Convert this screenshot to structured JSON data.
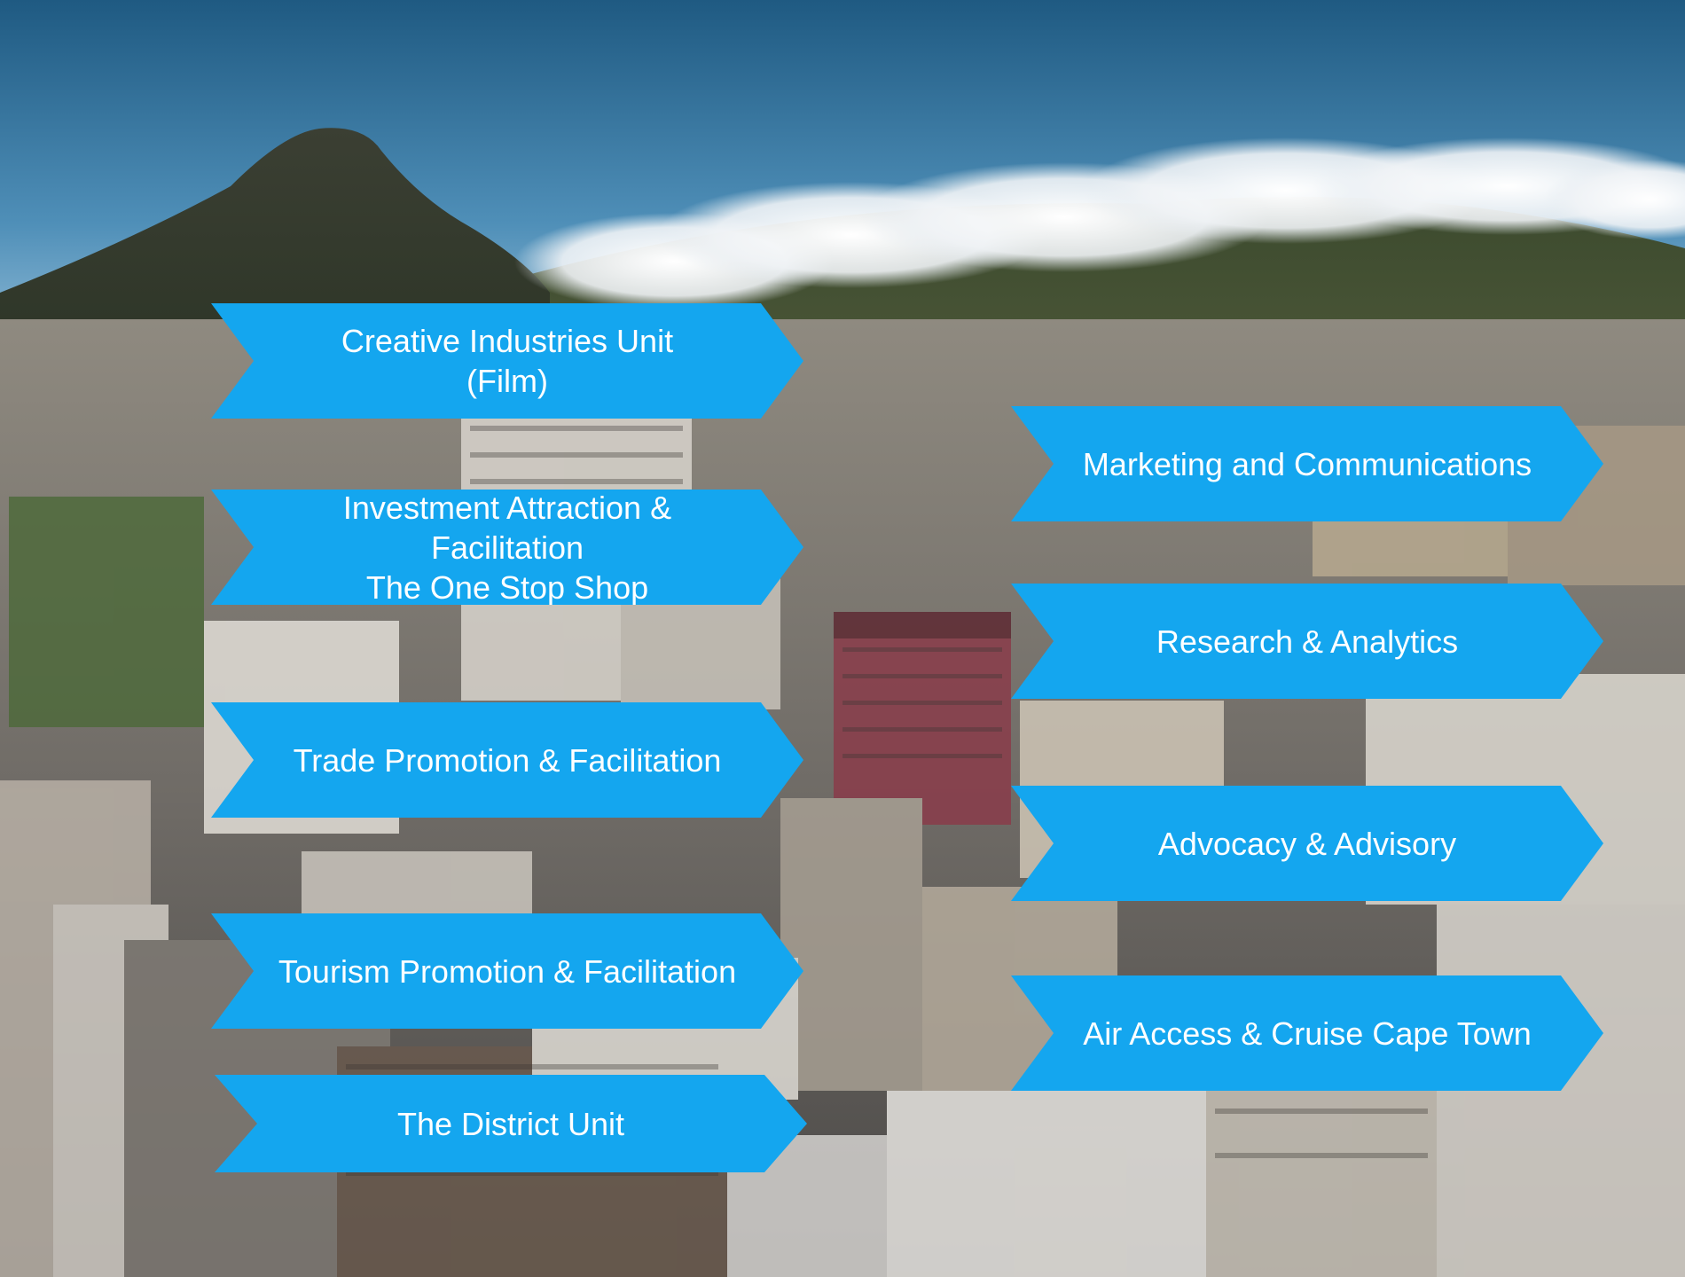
{
  "background": {
    "description_icon": "cape-town-city-skyline-photo",
    "sky_color": "#2e6d96",
    "chevron_color": "#14a6ef"
  },
  "left_column": [
    {
      "id": "creative",
      "lines": [
        "Creative Industries Unit",
        "(Film)"
      ]
    },
    {
      "id": "invest",
      "lines": [
        "Investment Attraction &",
        "Facilitation",
        "The One Stop Shop"
      ]
    },
    {
      "id": "trade",
      "lines": [
        "Trade Promotion & Facilitation"
      ]
    },
    {
      "id": "tourism",
      "lines": [
        "Tourism Promotion & Facilitation"
      ]
    },
    {
      "id": "district",
      "lines": [
        "The District Unit"
      ]
    }
  ],
  "right_column": [
    {
      "id": "marketing",
      "lines": [
        "Marketing and Communications"
      ]
    },
    {
      "id": "research",
      "lines": [
        "Research & Analytics"
      ]
    },
    {
      "id": "advocacy",
      "lines": [
        "Advocacy & Advisory"
      ]
    },
    {
      "id": "air",
      "lines": [
        "Air Access & Cruise Cape Town"
      ]
    }
  ]
}
